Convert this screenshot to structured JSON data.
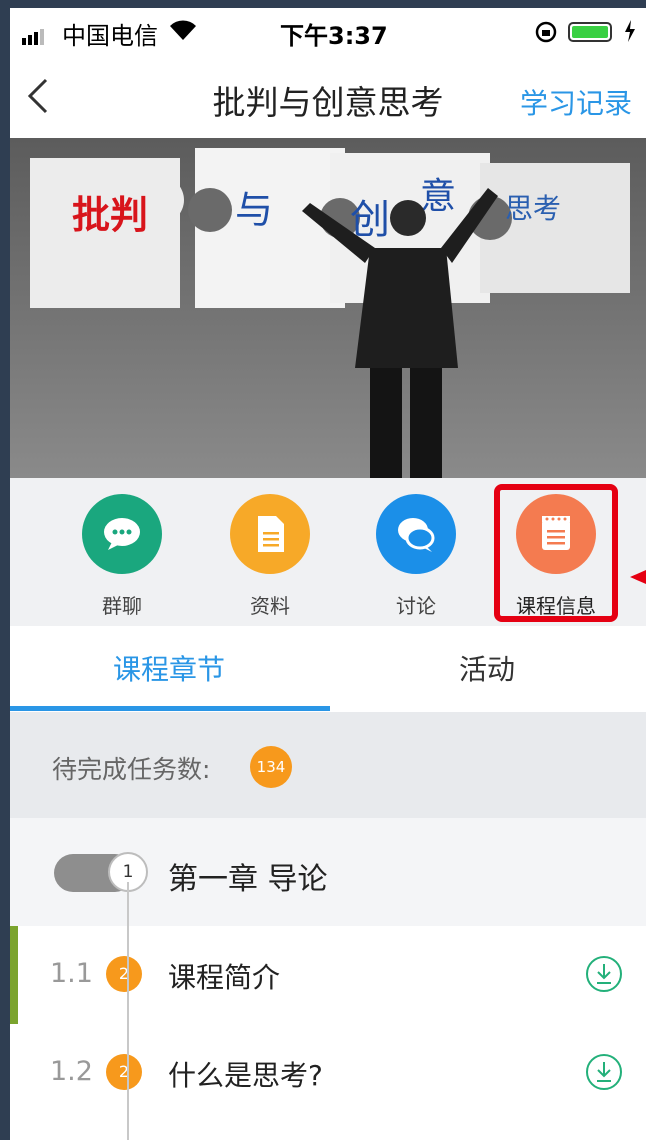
{
  "status_bar": {
    "carrier": "中国电信",
    "time": "下午3:37"
  },
  "nav": {
    "title": "批判与创意思考",
    "record_link": "学习记录"
  },
  "banner": {
    "puzzle_texts": [
      "批判",
      "与",
      "创",
      "意",
      "思考"
    ]
  },
  "quick_actions": [
    {
      "label": "群聊",
      "color": "#1aa77e"
    },
    {
      "label": "资料",
      "color": "#f7a928"
    },
    {
      "label": "讨论",
      "color": "#1b8fe8"
    },
    {
      "label": "课程信息",
      "color": "#f47b50"
    }
  ],
  "tabs": [
    {
      "label": "课程章节"
    },
    {
      "label": "活动"
    }
  ],
  "pending": {
    "label": "待完成任务数:",
    "count": "134"
  },
  "chapter": {
    "number": "1",
    "title": "第一章  导论"
  },
  "sections": [
    {
      "num": "1.1",
      "tasks": "2",
      "title": "课程简介"
    },
    {
      "num": "1.2",
      "tasks": "2",
      "title": "什么是思考?"
    }
  ]
}
